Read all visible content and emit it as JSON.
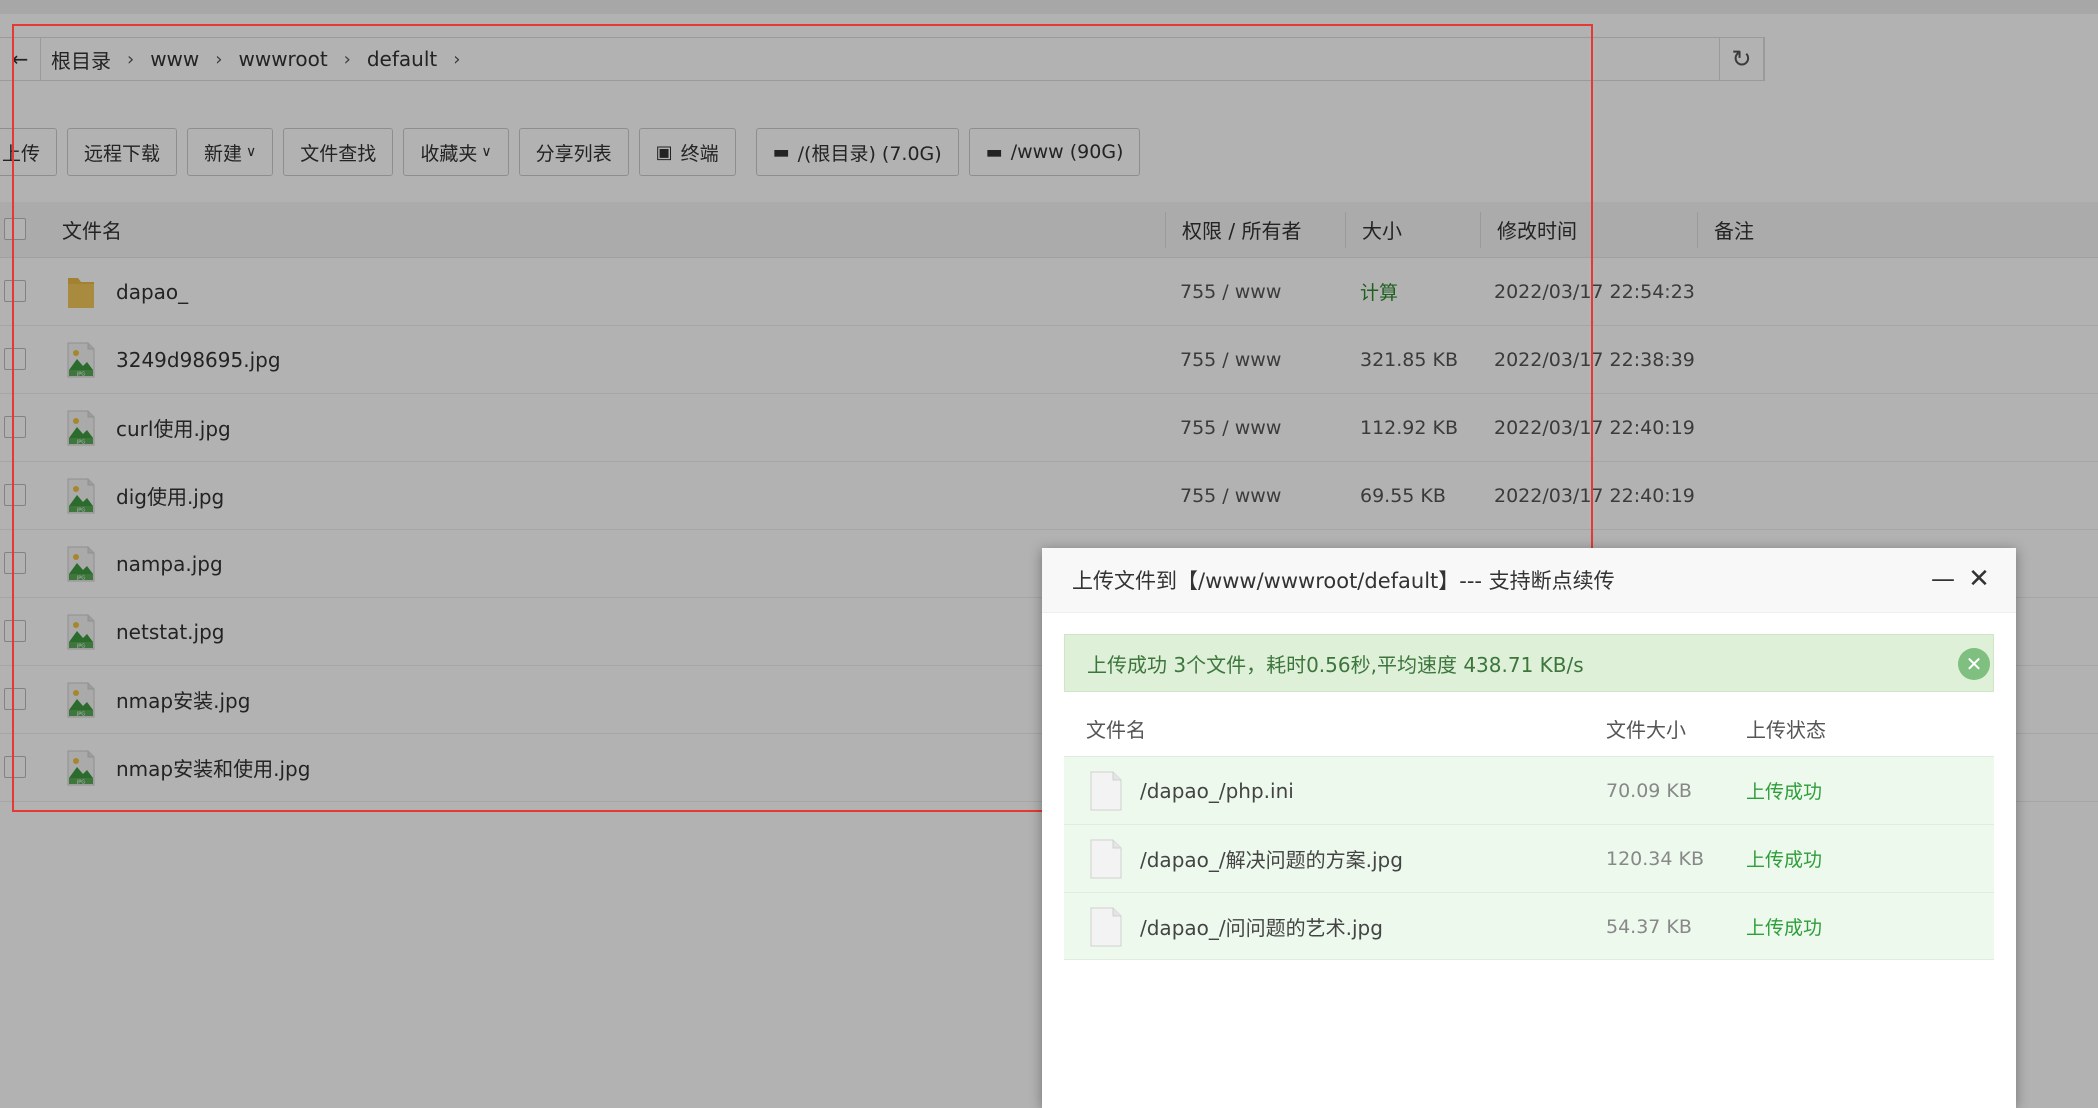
{
  "breadcrumb": {
    "back_icon": "arrow-left-icon",
    "items": [
      "根目录",
      "www",
      "wwwroot",
      "default"
    ],
    "refresh_icon": "refresh-icon"
  },
  "toolbar": {
    "upload": "上传",
    "remote_download": "远程下载",
    "new": "新建",
    "file_search": "文件查找",
    "favorites": "收藏夹",
    "share_list": "分享列表",
    "terminal": "终端",
    "disk_root": "/(根目录) (7.0G)",
    "disk_www": "/www (90G)"
  },
  "table": {
    "headers": {
      "name": "文件名",
      "perm": "权限 / 所有者",
      "size": "大小",
      "mtime": "修改时间",
      "note": "备注"
    },
    "rows": [
      {
        "name": "dapao_",
        "type": "folder",
        "perm": "755 / www",
        "size": "计算",
        "mtime": "2022/03/17 22:54:23"
      },
      {
        "name": "3249d98695.jpg",
        "type": "jpg",
        "perm": "755 / www",
        "size": "321.85 KB",
        "mtime": "2022/03/17 22:38:39"
      },
      {
        "name": "curl使用.jpg",
        "type": "jpg",
        "perm": "755 / www",
        "size": "112.92 KB",
        "mtime": "2022/03/17 22:40:19"
      },
      {
        "name": "dig使用.jpg",
        "type": "jpg",
        "perm": "755 / www",
        "size": "69.55 KB",
        "mtime": "2022/03/17 22:40:19"
      },
      {
        "name": "nampa.jpg",
        "type": "jpg",
        "perm": "",
        "size": "",
        "mtime": ""
      },
      {
        "name": "netstat.jpg",
        "type": "jpg",
        "perm": "",
        "size": "",
        "mtime": ""
      },
      {
        "name": "nmap安装.jpg",
        "type": "jpg",
        "perm": "",
        "size": "",
        "mtime": ""
      },
      {
        "name": "nmap安装和使用.jpg",
        "type": "jpg",
        "perm": "",
        "size": "",
        "mtime": ""
      }
    ]
  },
  "dialog": {
    "title": "上传文件到【/www/wwwroot/default】--- 支持断点续传",
    "alert": "上传成功 3个文件，耗时0.56秒,平均速度 438.71 KB/s",
    "headers": {
      "name": "文件名",
      "size": "文件大小",
      "status": "上传状态"
    },
    "files": [
      {
        "name": "/dapao_/php.ini",
        "size": "70.09 KB",
        "status": "上传成功"
      },
      {
        "name": "/dapao_/解决问题的方案.jpg",
        "size": "120.34 KB",
        "status": "上传成功"
      },
      {
        "name": "/dapao_/问问题的艺术.jpg",
        "size": "54.37 KB",
        "status": "上传成功"
      }
    ]
  },
  "colors": {
    "success_green": "#2e9e3a",
    "alert_bg": "#dff0d8",
    "highlight_red": "#e53935"
  }
}
